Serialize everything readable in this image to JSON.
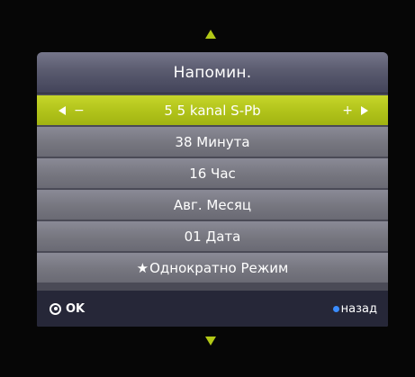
{
  "dialog": {
    "title": "Напомин.",
    "channel": {
      "minus": "−",
      "value": "5 5 kanal S-Pb",
      "plus": "+"
    },
    "rows": [
      {
        "label": "38 Минута"
      },
      {
        "label": "16 Час"
      },
      {
        "label": "Авг. Месяц"
      },
      {
        "label": "01 Дата"
      },
      {
        "label": "Однократно Режим"
      }
    ],
    "mode_icon": "star-icon"
  },
  "footer": {
    "ok_label": "OK",
    "back_label": "назад"
  },
  "colors": {
    "accent": "#b2c816",
    "selected_row": "#b0c21a",
    "row": "#76767f",
    "header": "#5a5b6f",
    "footer": "#262738",
    "back_dot": "#3a8cff"
  },
  "icons": [
    "up-arrow-icon",
    "down-arrow-icon",
    "left-arrow-icon",
    "right-arrow-icon",
    "star-icon",
    "ok-circle-icon",
    "blue-button-icon"
  ]
}
